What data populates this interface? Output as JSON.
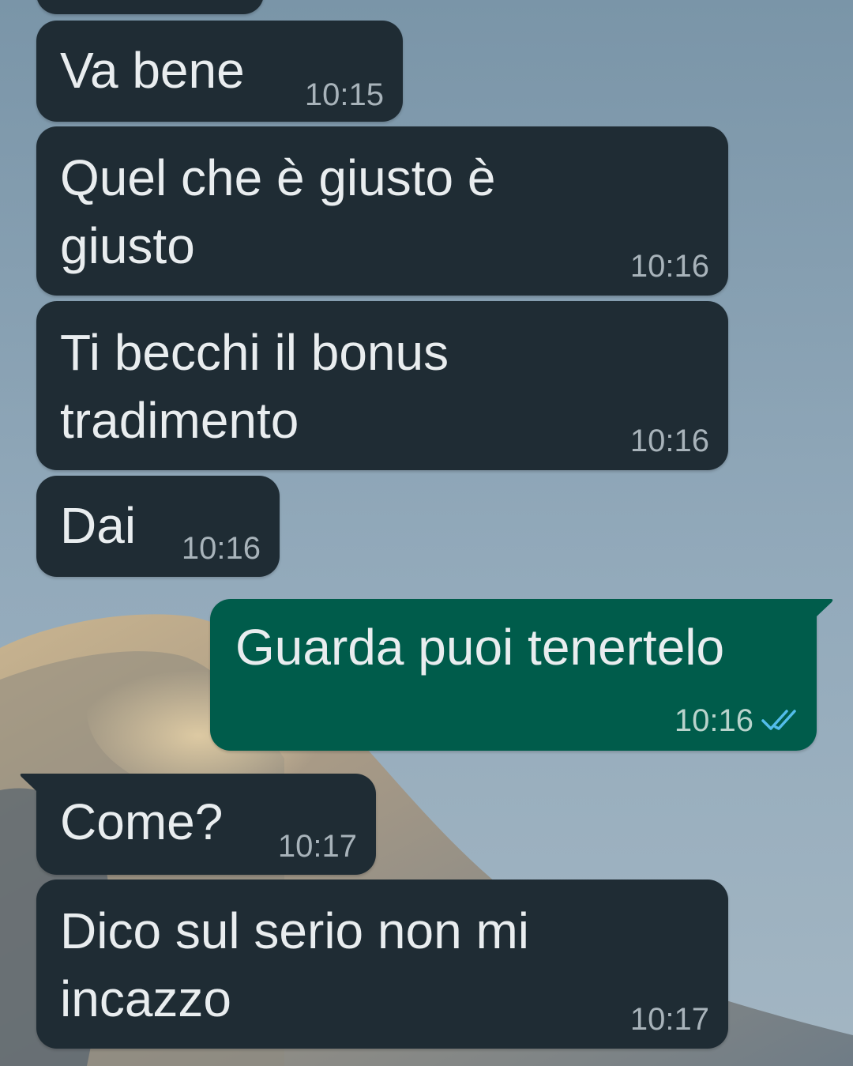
{
  "chat": {
    "messages": [
      {
        "text": "Va bene",
        "time": "10:15",
        "direction": "incoming"
      },
      {
        "text": "Quel che è giusto è giusto",
        "line1": "Quel che è giusto è",
        "line2": "giusto",
        "time": "10:16",
        "direction": "incoming"
      },
      {
        "text": "Ti becchi il bonus tradimento",
        "line1": "Ti becchi il bonus",
        "line2": "tradimento",
        "time": "10:16",
        "direction": "incoming"
      },
      {
        "text": "Dai",
        "time": "10:16",
        "direction": "incoming"
      },
      {
        "text": "Guarda puoi tenertelo",
        "time": "10:16",
        "direction": "outgoing",
        "status": "read-double-check-icon"
      },
      {
        "text": "Come?",
        "time": "10:17",
        "direction": "incoming"
      },
      {
        "text": "Dico sul serio non mi incazzo",
        "line1": "Dico sul serio non mi",
        "line2": "incazzo",
        "time": "10:17",
        "direction": "incoming"
      }
    ]
  },
  "colors": {
    "incoming_bubble": "#1f2c34",
    "outgoing_bubble": "#005c4b",
    "read_ticks": "#53bdeb",
    "text": "#e9edef"
  }
}
